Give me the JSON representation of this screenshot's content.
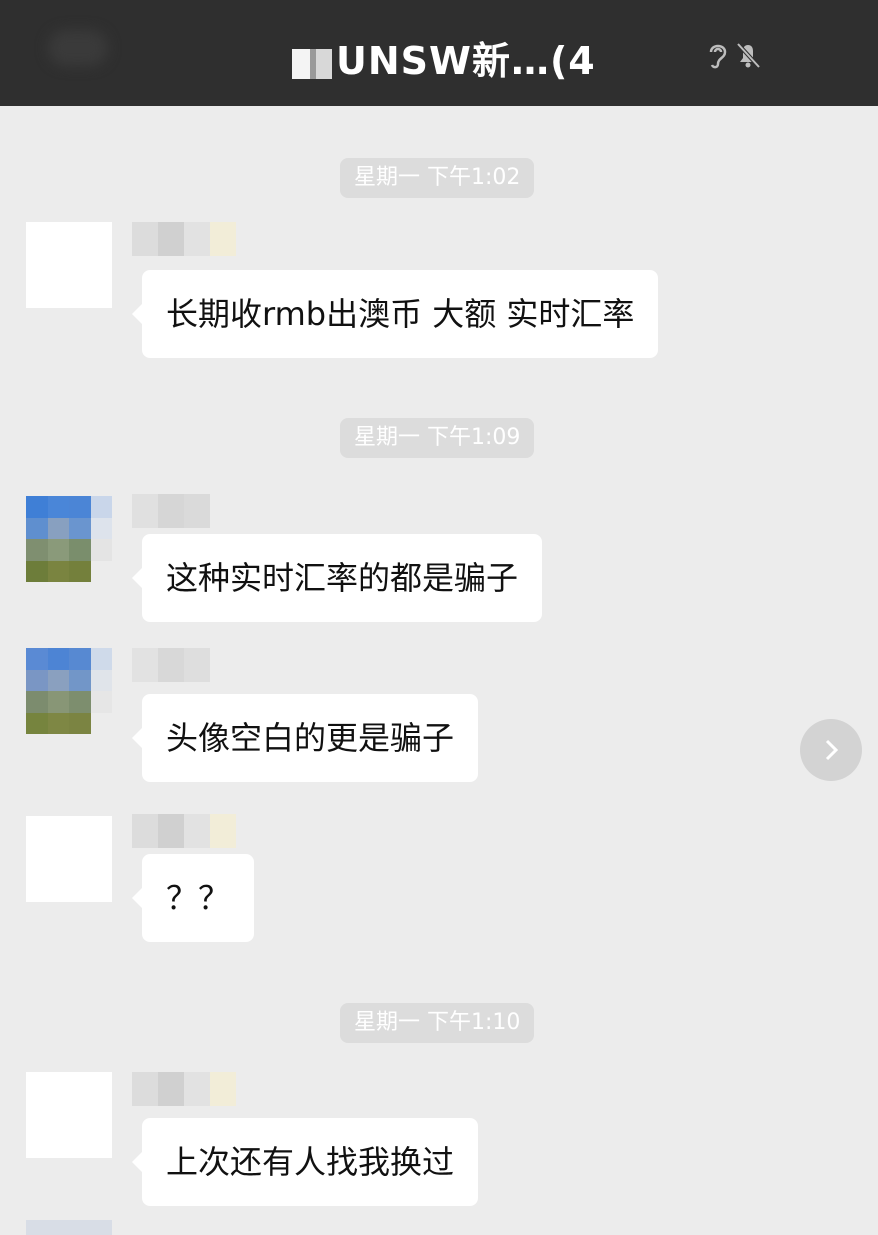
{
  "header": {
    "title": "UNSW新…(4",
    "icons": [
      "ear-icon",
      "mute-bell-icon"
    ]
  },
  "timestamps": [
    "星期一 下午1:02",
    "星期一 下午1:09",
    "星期一 下午1:10"
  ],
  "messages": [
    {
      "text": "长期收rmb出澳币 大额 实时汇率",
      "avatar": "blank"
    },
    {
      "text": "这种实时汇率的都是骗子",
      "avatar": "pixelated"
    },
    {
      "text": "头像空白的更是骗子",
      "avatar": "pixelated"
    },
    {
      "text": "？？",
      "avatar": "blank"
    },
    {
      "text": "上次还有人找我换过",
      "avatar": "blank"
    }
  ],
  "colors": {
    "header_bg": "#2f2f2f",
    "chat_bg": "#ececec",
    "bubble_bg": "#ffffff",
    "timestamp_bg": "#dcdcdc"
  }
}
